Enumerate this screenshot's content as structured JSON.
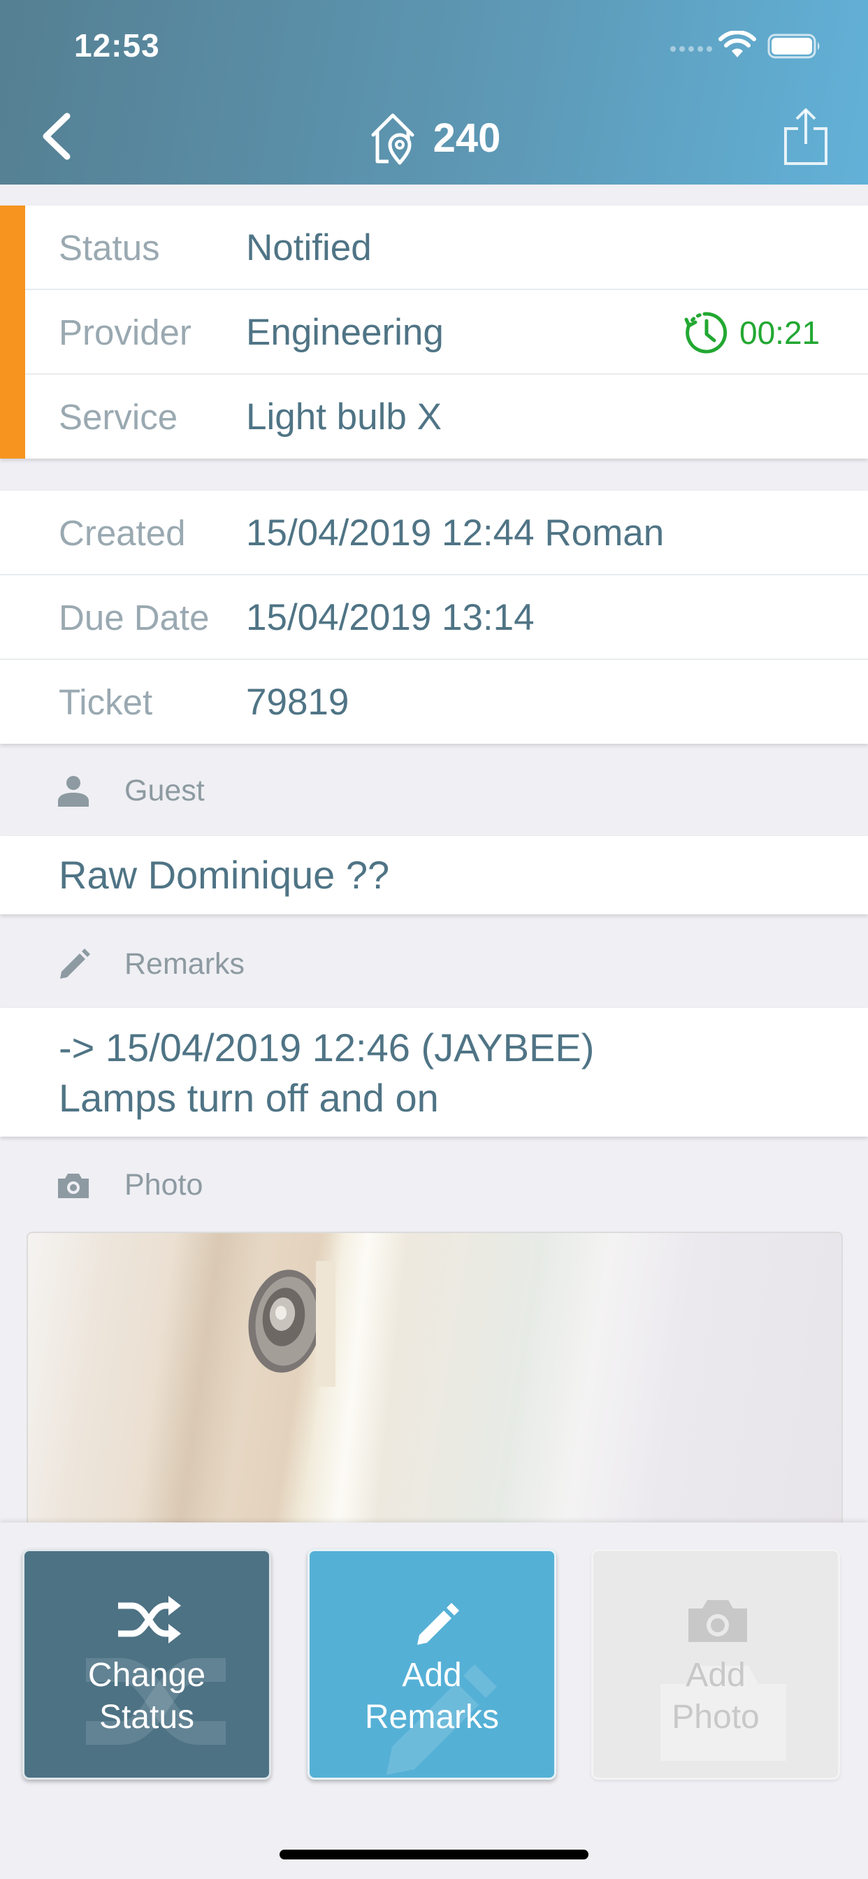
{
  "status_bar": {
    "time": "12:53"
  },
  "header": {
    "room_number": "240",
    "icons": {
      "back": "chevron-left-icon",
      "room": "home-location-icon",
      "share": "share-icon"
    }
  },
  "colors": {
    "accent_priority": "#f6941f",
    "header_gradient_start": "#557f92",
    "header_gradient_end": "#62b1d8",
    "timer_green": "#22a832",
    "value_text": "#4f7485",
    "button_change_status": "#4d7284",
    "button_add_remarks": "#55b0d6",
    "button_add_photo_disabled": "#e9e9e9"
  },
  "summary": {
    "status_label": "Status",
    "status_value": "Notified",
    "provider_label": "Provider",
    "provider_value": "Engineering",
    "timer": "00:21",
    "service_label": "Service",
    "service_value": "Light bulb X"
  },
  "details": {
    "created_label": "Created",
    "created_value": "15/04/2019 12:44 Roman",
    "due_label": "Due Date",
    "due_value": "15/04/2019 13:14",
    "ticket_label": "Ticket",
    "ticket_value": "79819"
  },
  "guest": {
    "section_label": "Guest",
    "name": "Raw Dominique ??"
  },
  "remarks": {
    "section_label": "Remarks",
    "lines": [
      "-> 15/04/2019 12:46 (JAYBEE)",
      "Lamps turn off and on"
    ]
  },
  "photo": {
    "section_label": "Photo"
  },
  "actions": {
    "change_status": [
      "Change",
      "Status"
    ],
    "add_remarks": [
      "Add",
      "Remarks"
    ],
    "add_photo": [
      "Add",
      "Photo"
    ]
  }
}
